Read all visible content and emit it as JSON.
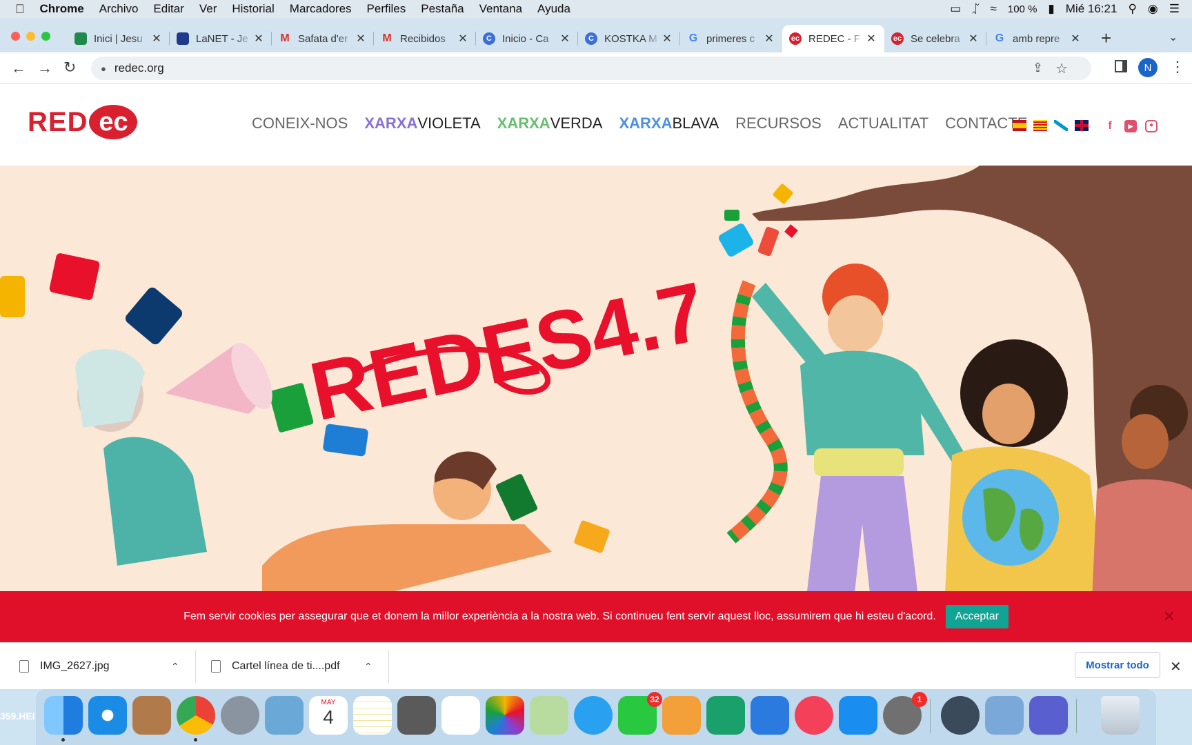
{
  "menubar": {
    "app": "Chrome",
    "items": [
      "Archivo",
      "Editar",
      "Ver",
      "Historial",
      "Marcadores",
      "Perfiles",
      "Pestaña",
      "Ventana",
      "Ayuda"
    ],
    "battery": "100 %",
    "clock": "Mié 16:21"
  },
  "tabs": [
    {
      "label": "Inici | Jesu",
      "color": "#1f8a4c"
    },
    {
      "label": "LaNET - Je",
      "color": "#1d3b8a"
    },
    {
      "label": "Safata d'er",
      "color": "#d93025"
    },
    {
      "label": "Recibidos",
      "color": "#d93025"
    },
    {
      "label": "Inicio - Ca",
      "color": "#3b6fd6"
    },
    {
      "label": "KOSTKA M",
      "color": "#3b6fd6"
    },
    {
      "label": "primeres c",
      "color": "#4285f4"
    },
    {
      "label": "REDEC - F",
      "color": "#d9202f"
    },
    {
      "label": "Se celebra",
      "color": "#d9202f"
    },
    {
      "label": "amb repre",
      "color": "#4285f4"
    }
  ],
  "address": {
    "url": "redec.org"
  },
  "profile_initial": "N",
  "site": {
    "logo_text": "RED",
    "logo_badge": "ec",
    "nav": {
      "coneix": "CONEIX-NOS",
      "xarxa1": "XARXA",
      "violeta": "VIOLETA",
      "xarxa2": "XARXA",
      "verda": "VERDA",
      "xarxa3": "XARXA",
      "blava": "BLAVA",
      "recursos": "RECURSOS",
      "actualitat": "ACTUALITAT",
      "contacte": "CONTACTE"
    },
    "hero_title": "REDES4.7"
  },
  "cookie": {
    "message": "Fem servir cookies per assegurar que et donem la millor experiència a la nostra web. Si continueu fent servir aquest lloc, assumirem que hi esteu d'acord.",
    "accept": "Acceptar"
  },
  "downloads": {
    "items": [
      "IMG_2627.jpg",
      "Cartel línea de ti....pdf"
    ],
    "show_all": "Mostrar todo"
  },
  "dock": {
    "calendar_month": "MAY",
    "calendar_day": "4",
    "facetime_badge": "32",
    "prefs_badge": "1"
  },
  "desktop_label": "359.HEI"
}
